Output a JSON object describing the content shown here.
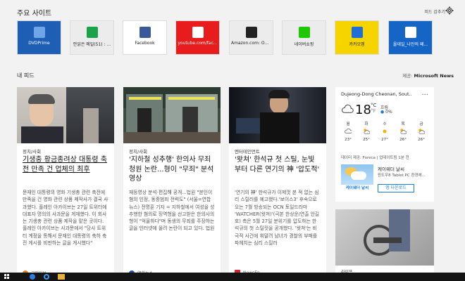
{
  "top_sites": {
    "title": "주요 사이트",
    "hide_label": "피드 감추기",
    "tiles": [
      {
        "label": "DVDPrime",
        "bg": "#1e5fb5",
        "fg": "#ffffff",
        "icon": "dvdprime-icon",
        "icon_color": "#6fa6e8"
      },
      {
        "label": "안읽은 메일(51) : ...",
        "bg": "#ececec",
        "fg": "#222222",
        "icon": "mail-icon",
        "icon_color": "#1aa34a"
      },
      {
        "label": "Facebook",
        "bg": "#ffffff",
        "fg": "#222222",
        "icon": "facebook-icon",
        "icon_color": "#3b5998"
      },
      {
        "label": "youtube.com/fac...",
        "bg": "#e81c1c",
        "fg": "#ffffff",
        "icon": "youtube-icon",
        "icon_color": "#ffffff"
      },
      {
        "label": "Amazon.com: Onl...",
        "bg": "#ececec",
        "fg": "#222222",
        "icon": "amazon-icon",
        "icon_color": "#222222"
      },
      {
        "label": "네이버쇼핑",
        "bg": "#ececec",
        "fg": "#222222",
        "icon": "naver-shopping-icon",
        "icon_color": "#1ec800"
      },
      {
        "label": "카카오맵",
        "bg": "#f5d400",
        "fg": "#222222",
        "icon": "kakaomap-icon",
        "icon_color": "#1f6fd6"
      },
      {
        "label": "올데일_나만의 페...",
        "bg": "#1565c7",
        "fg": "#ffffff",
        "icon": "alldaily-icon",
        "icon_color": "#ffffff"
      }
    ]
  },
  "feed": {
    "title": "내 피드",
    "provider_prefix": "제공:",
    "provider_name": "Microsoft News"
  },
  "cards": [
    {
      "category": "정치/사회",
      "headline": "기생충 황금종려상 대통령 축전 만족 건 업체의 최후",
      "body": "문재인 대통령의 영화 기생충 관련 축전에 만족을 건 영화 관련 상품 제작사가 결국 사과했다. 플레인 아카이브는 27일 트위터에 대표자 명의의 사과문을 게재했다. 이 회사는 기생충 관련 상품 제작을 맡은 곳이다. 플레인 아카이브는 사과문에서 \"당사 트위터 계정을 통해서 문재인 대통령의 축하 축전 게시를 비판하는 글을 게시했다\"",
      "source": "국민일보",
      "source_color": "#e07b22"
    },
    {
      "category": "정치/사회",
      "headline": "'지하철 성추행' 한의사 무죄 청원 논란...형이 \"무죄\" 분석 영상",
      "body": "재등영상 분석·편집해 공개...법원 \"본인이 혐의 인정, 동종범죄 전력도\" (서울=연합뉴스) 전명훈 기자 = 지하철에서 여성을 성추행한 혐의로 징역형을 선고받은 한의사의 형이 \"억울하다\"며 동생의 무죄를 주장하는 글을 인터넷에 올려 논란이 되고 있다. 법원",
      "source": "연합뉴스",
      "source_color": "#1e4fa3"
    },
    {
      "category": "엔터테인먼트",
      "headline": "'왓쳐' 한석규 첫 스틸, 눈빛부터 다른 연기의 神 '압도적'",
      "body": "'연기의 神' 한석규가 이제껏 본 적 없는 심리 스릴러를 예고했다.'보이스3' 후속으로 오는 7월 방송되는 OCN 토일드라마 'WATCHER(왓쳐)'(극본 한상운/연출 안길호) 측은 5월 27일 분위기를 압도하는 한석규의 첫 스틸컷을 공개했다. '왓쳐'는 비극적 사건에 휘말려 남녀가 경찰의 부패를 파헤치는 심리 스릴러",
      "source": "NewsEn",
      "source_color": "#d7262d"
    }
  ],
  "weather": {
    "location": "Dujeong-Dong Cheonan, Sout...",
    "more": "...",
    "temp": "18",
    "unit": "°C",
    "unit2": "°F",
    "condition": "흐림",
    "rain": "0%",
    "days": [
      {
        "name": "월",
        "temp": "23°",
        "icon": "cloud-icon"
      },
      {
        "name": "화",
        "temp": "25°",
        "icon": "partly-sunny-icon"
      },
      {
        "name": "수",
        "temp": "27°",
        "icon": "sunny-icon"
      },
      {
        "name": "목",
        "temp": "26°",
        "icon": "partly-sunny-icon"
      },
      {
        "name": "금",
        "temp": "26°",
        "icon": "partly-sunny-icon"
      }
    ],
    "source": "데이터 제공: Foreca | 업데이트됨 1분 전",
    "ad_title": "케이웨더 날씨",
    "ad_sub": "윈도우8 Tablet PC 환경에...",
    "ad_button": "앱 다운로드",
    "ad_logo_text": "케이웨더 날씨"
  },
  "card5": {
    "category": "라이프"
  },
  "colors": {
    "background": "#f2f2f2",
    "card": "#ffffff",
    "accent": "#1a7ed6",
    "taskbar": "#141414"
  }
}
